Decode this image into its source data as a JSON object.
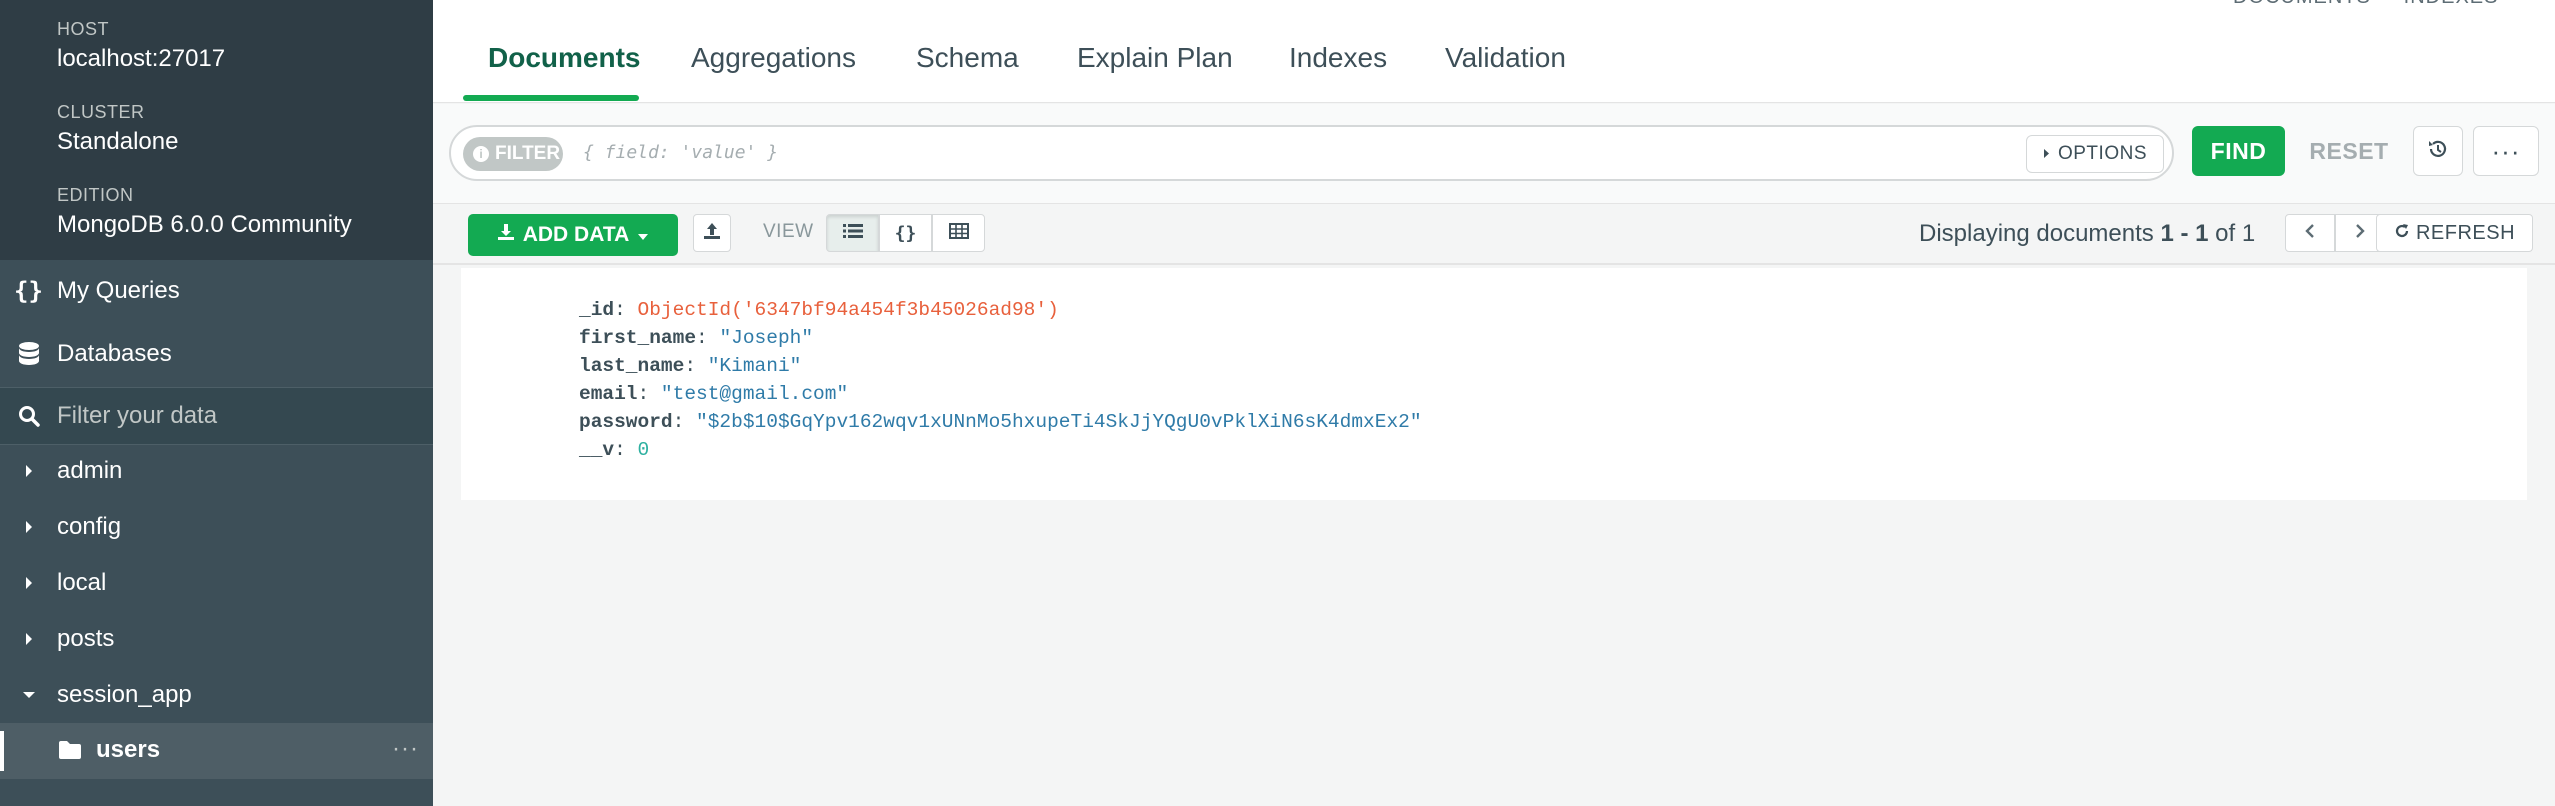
{
  "sidebar": {
    "host": {
      "label": "HOST",
      "value": "localhost:27017"
    },
    "cluster": {
      "label": "CLUSTER",
      "value": "Standalone"
    },
    "edition": {
      "label": "EDITION",
      "value": "MongoDB 6.0.0 Community"
    },
    "my_queries": {
      "icon": "{}",
      "label": "My Queries"
    },
    "databases": {
      "label": "Databases"
    },
    "filter": {
      "placeholder": "Filter your data"
    },
    "dbs": [
      {
        "label": "admin"
      },
      {
        "label": "config"
      },
      {
        "label": "local"
      },
      {
        "label": "posts"
      },
      {
        "label": "session_app"
      }
    ],
    "collection": {
      "label": "users",
      "more": "···"
    }
  },
  "tabs": [
    {
      "label": "Documents"
    },
    {
      "label": "Aggregations"
    },
    {
      "label": "Schema"
    },
    {
      "label": "Explain Plan"
    },
    {
      "label": "Indexes"
    },
    {
      "label": "Validation"
    }
  ],
  "top_crumb": "DOCUMENTS     INDEXES",
  "query": {
    "filter_label": "FILTER",
    "filter_placeholder": "{ field: 'value' }",
    "options_label": "OPTIONS",
    "find_label": "FIND",
    "reset_label": "RESET",
    "more_label": "···"
  },
  "toolbar": {
    "add_data_label": "ADD DATA",
    "view_label": "VIEW",
    "view_json_glyph": "{}",
    "displaying_prefix": "Displaying documents ",
    "range": "1 - 1",
    "of_text": " of ",
    "total": "1",
    "refresh_label": "REFRESH"
  },
  "document": {
    "id_key": "_id",
    "id_value": "ObjectId('6347bf94a454f3b45026ad98')",
    "first_name_key": "first_name",
    "first_name_value": "\"Joseph\"",
    "last_name_key": "last_name",
    "last_name_value": "\"Kimani\"",
    "email_key": "email",
    "email_value": "\"test@gmail.com\"",
    "password_key": "password",
    "password_value": "\"$2b$10$GqYpv162wqv1xUNnMo5hxupeTi4SkJjYQgU0vPklXiN6sK4dmxEx2\"",
    "v_key": "__v",
    "v_value": "0"
  },
  "colors": {
    "sidebar_bg": "#3d4f58",
    "accent_green": "#13aa52",
    "objectid": "#e8603c",
    "string_value": "#2f7ba8"
  }
}
